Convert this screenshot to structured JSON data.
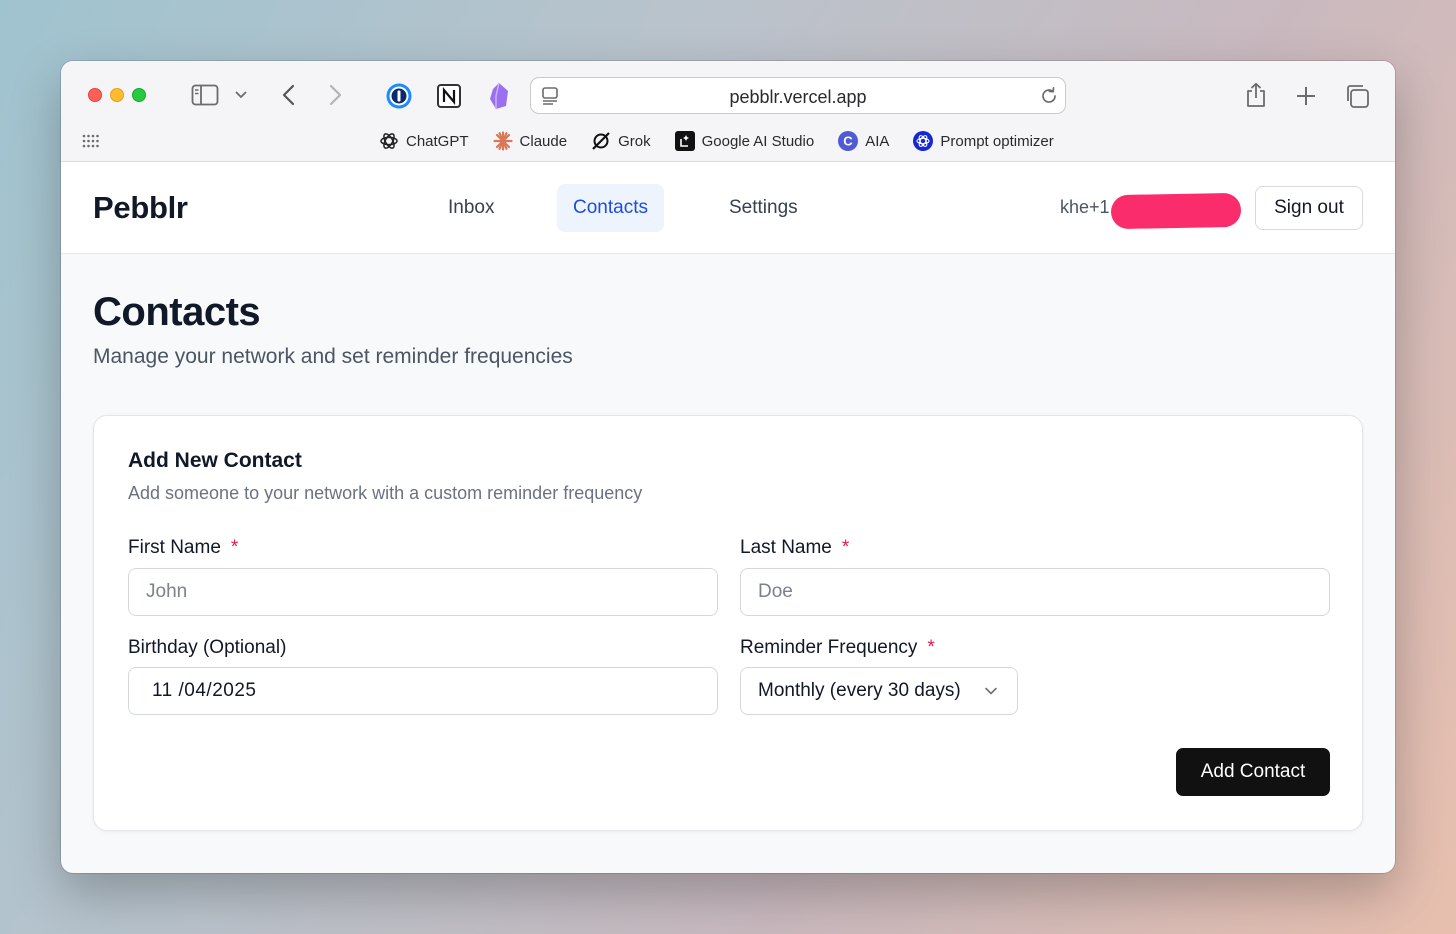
{
  "browser": {
    "url": "pebblr.vercel.app",
    "bookmarks": [
      {
        "label": "ChatGPT",
        "icon": "chatgpt-icon"
      },
      {
        "label": "Claude",
        "icon": "claude-icon"
      },
      {
        "label": "Grok",
        "icon": "grok-icon"
      },
      {
        "label": "Google AI Studio",
        "icon": "google-ai-studio-icon"
      },
      {
        "label": "AIA",
        "icon": "aia-icon"
      },
      {
        "label": "Prompt optimizer",
        "icon": "prompt-optimizer-icon"
      }
    ],
    "aia_letter": "C"
  },
  "nav": {
    "brand": "Pebblr",
    "links": [
      "Inbox",
      "Contacts",
      "Settings"
    ],
    "active": "Contacts",
    "user_email_visible": "khe+1",
    "sign_out": "Sign out"
  },
  "page": {
    "title": "Contacts",
    "subtitle": "Manage your network and set reminder frequencies"
  },
  "form": {
    "title": "Add New Contact",
    "subtitle": "Add someone to your network with a custom reminder frequency",
    "first_name": {
      "label": "First Name",
      "required_mark": "*",
      "placeholder": "John",
      "value": ""
    },
    "last_name": {
      "label": "Last Name",
      "required_mark": "*",
      "placeholder": "Doe",
      "value": ""
    },
    "birthday": {
      "label": "Birthday (Optional)",
      "value": "11 /04/2025"
    },
    "frequency": {
      "label": "Reminder Frequency",
      "required_mark": "*",
      "selected": "Monthly (every 30 days)"
    },
    "submit": "Add Contact"
  },
  "colors": {
    "active_nav_bg": "#eef4fd",
    "active_nav_text": "#1d4ed8",
    "required": "#e11d48",
    "primary_button": "#111111",
    "redaction": "#fb2c6c"
  }
}
